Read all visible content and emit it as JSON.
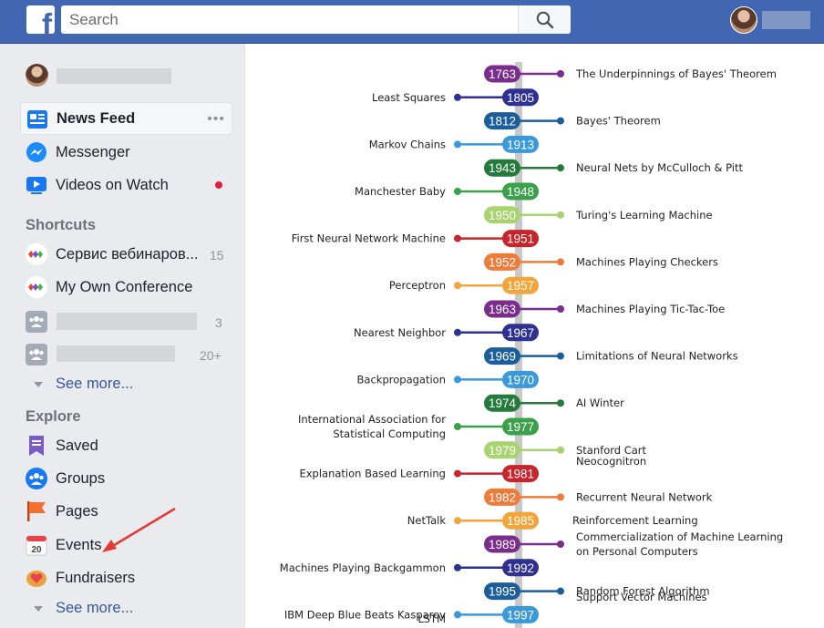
{
  "header": {
    "logo": "f",
    "search_placeholder": "Search",
    "search_icon": "search-icon",
    "brand_color": "#4267b2"
  },
  "sidebar": {
    "nav": [
      {
        "label": "News Feed",
        "icon": "news-feed-icon",
        "more": "•••"
      },
      {
        "label": "Messenger",
        "icon": "messenger-icon"
      },
      {
        "label": "Videos on Watch",
        "icon": "watch-icon"
      }
    ],
    "shortcuts_title": "Shortcuts",
    "shortcuts": [
      {
        "label": "Сервис вебинаров...",
        "count": "15"
      },
      {
        "label": "My Own Conference",
        "count": ""
      },
      {
        "label": "",
        "count": "3"
      },
      {
        "label": "",
        "count": "20+"
      }
    ],
    "see_more_1": "See more...",
    "explore_title": "Explore",
    "explore": [
      {
        "label": "Saved",
        "icon": "saved-icon"
      },
      {
        "label": "Groups",
        "icon": "groups-icon"
      },
      {
        "label": "Pages",
        "icon": "pages-flag-icon"
      },
      {
        "label": "Events",
        "icon": "calendar-icon",
        "icon_text": "20"
      },
      {
        "label": "Fundraisers",
        "icon": "fundraisers-icon"
      }
    ],
    "see_more_2": "See more..."
  },
  "timeline": {
    "events": [
      {
        "year": "1763",
        "label": "The Underpinnings of Bayes' Theorem",
        "side": "right",
        "color": "#7b2d8e"
      },
      {
        "year": "1805",
        "label": "Least Squares",
        "side": "left",
        "color": "#2e3192"
      },
      {
        "year": "1812",
        "label": "Bayes' Theorem",
        "side": "right",
        "color": "#1b5e9b"
      },
      {
        "year": "1913",
        "label": "Markov Chains",
        "side": "left",
        "color": "#3a9ad9"
      },
      {
        "year": "1943",
        "label": "Neural Nets by McCulloch & Pitt",
        "side": "right",
        "color": "#237a3b"
      },
      {
        "year": "1948",
        "label": "Manchester Baby",
        "side": "left",
        "color": "#3aa04a"
      },
      {
        "year": "1950",
        "label": "Turing's Learning Machine",
        "side": "right",
        "color": "#a8d46f"
      },
      {
        "year": "1951",
        "label": "First Neural Network Machine",
        "side": "left",
        "color": "#c8242b"
      },
      {
        "year": "1952",
        "label": "Machines Playing Checkers",
        "side": "right",
        "color": "#ef7b3b"
      },
      {
        "year": "1957",
        "label": "Perceptron",
        "side": "left",
        "color": "#f3a43b"
      },
      {
        "year": "1963",
        "label": "Machines Playing Tic-Tac-Toe",
        "side": "right",
        "color": "#7b2d8e"
      },
      {
        "year": "1967",
        "label": "Nearest Neighbor",
        "side": "left",
        "color": "#2e3192"
      },
      {
        "year": "1969",
        "label": "Limitations of Neural Networks",
        "side": "right",
        "color": "#1b5e9b"
      },
      {
        "year": "1970",
        "label": "Backpropagation",
        "side": "left",
        "color": "#3a9ad9"
      },
      {
        "year": "1974",
        "label": "AI Winter",
        "side": "right",
        "color": "#237a3b"
      },
      {
        "year": "1977",
        "label": "International Association for\nStatistical Computing",
        "side": "left",
        "color": "#3aa04a"
      },
      {
        "year": "1979",
        "label": "Stanford Cart",
        "side": "right",
        "color": "#a8d46f"
      },
      {
        "year": "1981",
        "label": "Explanation Based Learning",
        "side": "left",
        "color": "#c8242b"
      },
      {
        "year": "1982",
        "label": "Recurrent Neural Network",
        "side": "right",
        "color": "#ef7b3b"
      },
      {
        "year": "1985",
        "label": "NetTalk",
        "side": "left",
        "color": "#f3a43b"
      },
      {
        "year": "1989",
        "label": "Commercialization of Machine Learning\non Personal Computers",
        "side": "right",
        "color": "#7b2d8e"
      },
      {
        "year": "1992",
        "label": "Machines Playing Backgammon",
        "side": "left",
        "color": "#2e3192"
      },
      {
        "year": "1995",
        "label": "Random Forest Algorithm",
        "side": "right",
        "color": "#1b5e9b"
      },
      {
        "year": "1997",
        "label": "IBM Deep Blue Beats Kasparov",
        "side": "left",
        "color": "#3a9ad9"
      }
    ],
    "extra_labels": [
      {
        "text": "Neocognitron"
      },
      {
        "text": "Reinforcement Learning"
      },
      {
        "text": "Support Vector Machines"
      },
      {
        "text": "LSTM"
      }
    ]
  }
}
